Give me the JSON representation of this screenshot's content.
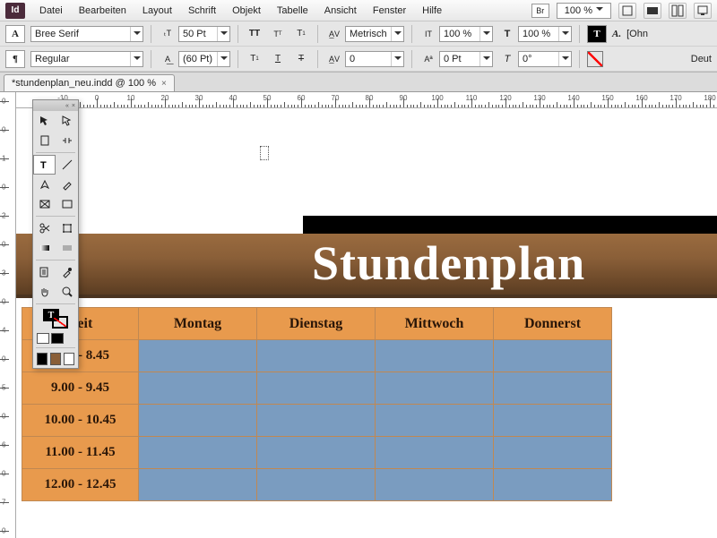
{
  "app": {
    "logo": "Id"
  },
  "menu": [
    "Datei",
    "Bearbeiten",
    "Layout",
    "Schrift",
    "Objekt",
    "Tabelle",
    "Ansicht",
    "Fenster",
    "Hilfe"
  ],
  "topright": {
    "br": "Br",
    "zoom": "100 %"
  },
  "control": {
    "font": "Bree Serif",
    "style": "Regular",
    "size": "50 Pt",
    "leading": "(60 Pt)",
    "kerning": "Metrisch",
    "tracking": "0",
    "vscale": "100 %",
    "hscale": "100 %",
    "baseline": "0 Pt",
    "ohne": "[Ohn",
    "lang": "Deut"
  },
  "tab": {
    "name": "*stundenplan_neu.indd @ 100 %"
  },
  "hruler_start": -10,
  "hruler_step": 10,
  "hruler_count": 21,
  "vruler_items": [
    "0",
    "0",
    "1",
    "0",
    "2",
    "0",
    "3",
    "0",
    "4",
    "0",
    "5",
    "0",
    "6",
    "0",
    "7",
    "0"
  ],
  "document": {
    "title": "Stundenplan",
    "headers": [
      "Zeit",
      "Montag",
      "Dienstag",
      "Mittwoch",
      "Donnerst"
    ],
    "times": [
      "8.00 - 8.45",
      "9.00 - 9.45",
      "10.00 - 10.45",
      "11.00 - 11.45",
      "12.00 - 12.45"
    ]
  },
  "colors": {
    "black": "#000",
    "brown": "#8a5f38",
    "white": "#fff"
  }
}
